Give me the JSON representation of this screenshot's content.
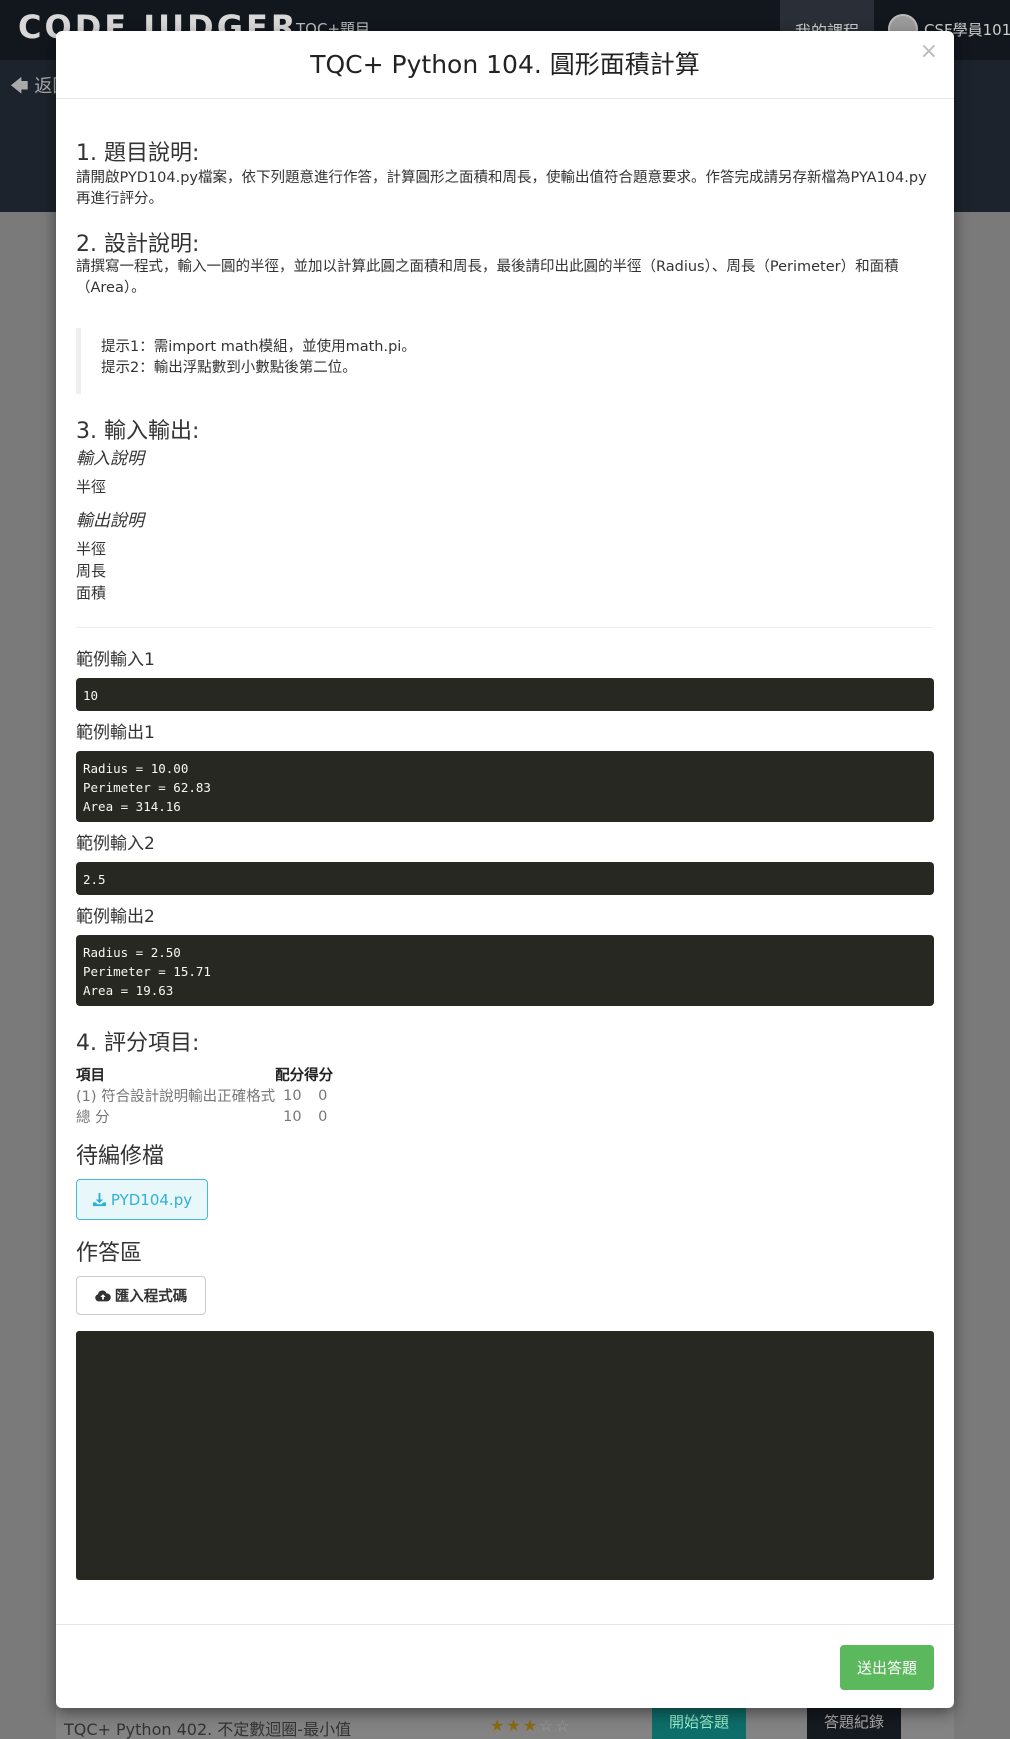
{
  "background": {
    "logo": "CODE JUDGER",
    "nav_link": "TQC+題目",
    "nav_active": "我的課程",
    "user": "CSF學員101",
    "back": "返回",
    "row": {
      "title": "TQC+ Python 402. 不定數迴圈-最小值",
      "rating": 3,
      "max_rating": 5,
      "start_button": "開始答題",
      "record_button": "答題紀錄"
    }
  },
  "modal": {
    "title": "TQC+ Python 104. 圓形面積計算",
    "close": "×",
    "section1": {
      "heading": "1. 題目說明:",
      "text": "請開啟PYD104.py檔案，依下列題意進行作答，計算圓形之面積和周長，使輸出值符合題意要求。作答完成請另存新檔為PYA104.py再進行評分。"
    },
    "section2": {
      "heading": "2. 設計說明:",
      "text": "請撰寫一程式，輸入一圓的半徑，並加以計算此圓之面積和周長，最後請印出此圓的半徑（Radius）、周長（Perimeter）和面積（Area）。",
      "hint1": "提示1：需import math模組，並使用math.pi。",
      "hint2": "提示2：輸出浮點數到小數點後第二位。"
    },
    "section3": {
      "heading": "3. 輸入輸出:",
      "input_label": "輸入說明",
      "input_text": "半徑",
      "output_label": "輸出說明",
      "output_lines": [
        "半徑",
        "周長",
        "面積"
      ]
    },
    "samples": {
      "in1_label": "範例輸入1",
      "in1": "10",
      "out1_label": "範例輸出1",
      "out1": "Radius = 10.00\nPerimeter = 62.83\nArea = 314.16",
      "in2_label": "範例輸入2",
      "in2": "2.5",
      "out2_label": "範例輸出2",
      "out2": "Radius = 2.50\nPerimeter = 15.71\nArea = 19.63"
    },
    "section4": {
      "heading": "4. 評分項目:",
      "headers": [
        "項目",
        "配分",
        "得分"
      ],
      "rows": [
        [
          "(1) 符合設計說明輸出正確格式",
          "10",
          "0"
        ],
        [
          "總 分",
          "10",
          "0"
        ]
      ]
    },
    "edit_section": {
      "heading": "待編修檔",
      "download_button": "PYD104.py"
    },
    "answer_section": {
      "heading": "作答區",
      "import_button": "匯入程式碼",
      "editor_content": ""
    },
    "submit_button": "送出答題"
  },
  "colors": {
    "code_bg": "#272822",
    "success": "#5cb85c",
    "info": "#31b0d5",
    "overlay": "#777777"
  },
  "icons": [
    "close-icon",
    "download-icon",
    "cloud-upload-icon",
    "arrow-left-icon",
    "star-icon",
    "avatar-icon"
  ]
}
